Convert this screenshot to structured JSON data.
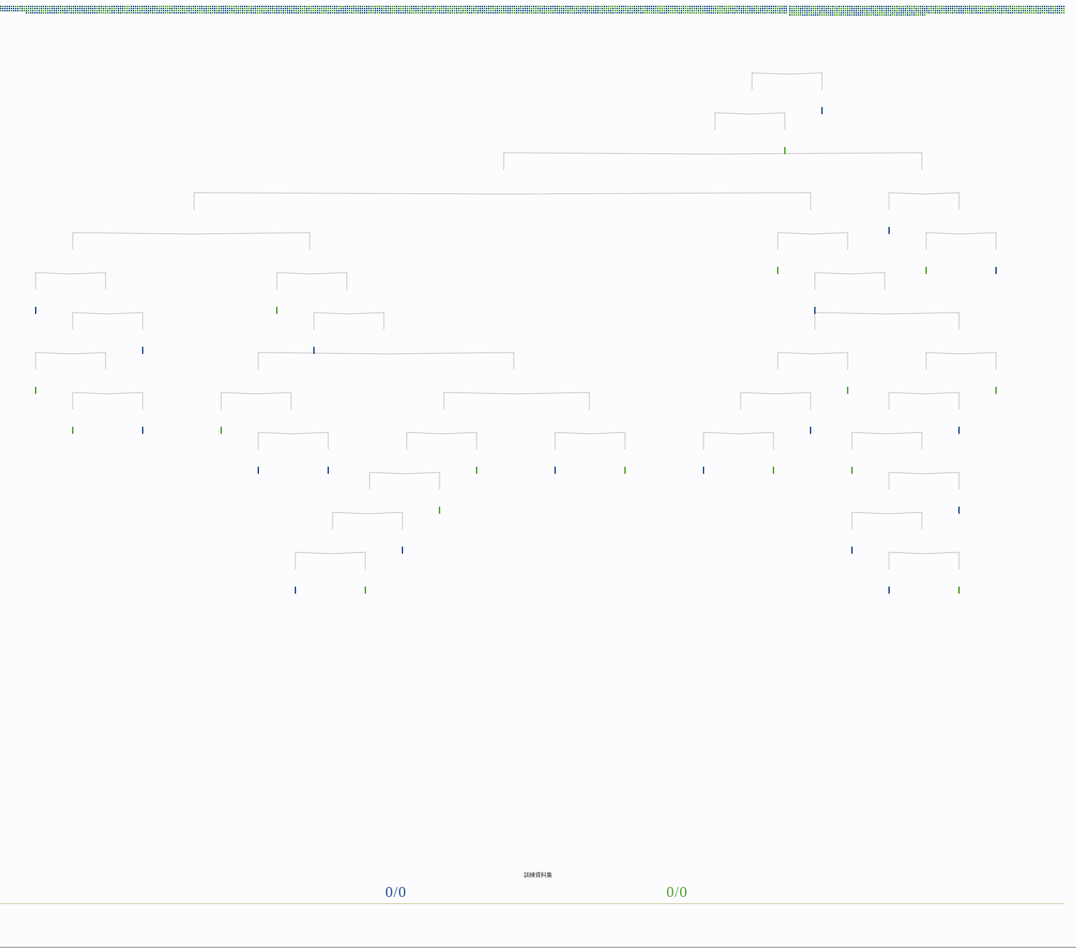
{
  "colors": {
    "class_a": "#1e4f8f",
    "class_b": "#4aa02c",
    "branch": "#bdbdb6",
    "baseline": "#c2c795"
  },
  "tree": {
    "leaves": [
      {
        "class": "a"
      },
      {
        "class": "b"
      },
      {
        "class": "a"
      },
      {
        "class": "a"
      },
      {
        "class": "b"
      },
      {
        "class": "b"
      },
      {
        "class": "a"
      },
      {
        "class": "b"
      },
      {
        "class": "a"
      },
      {
        "class": "b"
      },
      {
        "class": "a"
      },
      {
        "class": "a"
      },
      {
        "class": "b"
      },
      {
        "class": "b"
      },
      {
        "class": "a"
      },
      {
        "class": "a"
      },
      {
        "class": "b"
      },
      {
        "class": "a"
      },
      {
        "class": "b"
      },
      {
        "class": "b"
      },
      {
        "class": "a"
      },
      {
        "class": "b"
      },
      {
        "class": "a"
      },
      {
        "class": "a"
      },
      {
        "class": "b"
      },
      {
        "class": "b"
      },
      {
        "class": "a"
      },
      {
        "class": "b"
      },
      {
        "class": "a"
      },
      {
        "class": "a"
      },
      {
        "class": "a"
      },
      {
        "class": "b"
      },
      {
        "class": "a"
      },
      {
        "class": "b"
      },
      {
        "class": "a"
      },
      {
        "class": "b"
      },
      {
        "class": "a"
      },
      {
        "class": "b"
      }
    ]
  },
  "dataset": {
    "title": "訓練資料集",
    "left_count": "0/0",
    "right_count": "0/0"
  }
}
